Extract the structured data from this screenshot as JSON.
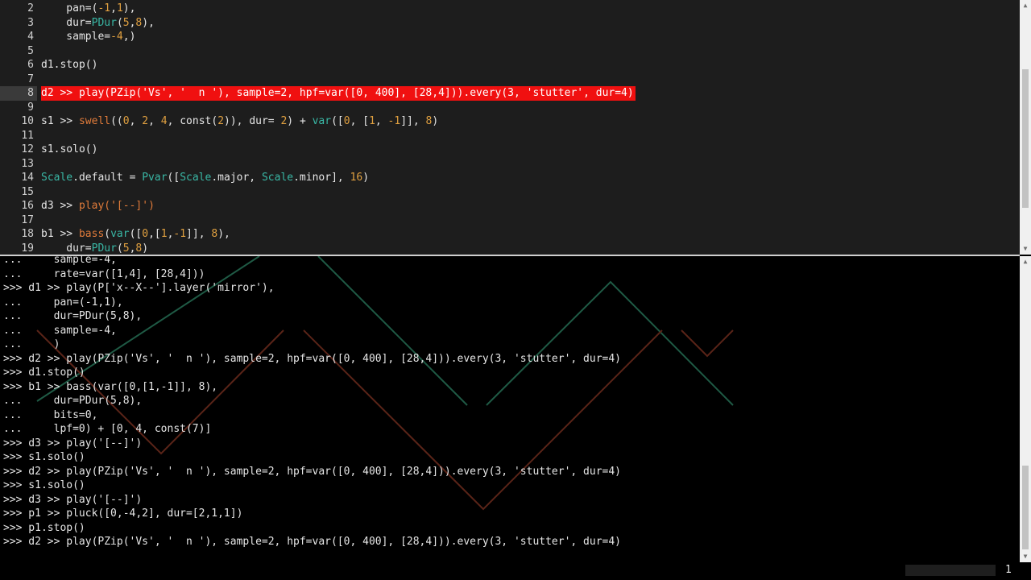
{
  "editor": {
    "line_numbers": [
      "2",
      "3",
      "4",
      "5",
      "6",
      "7",
      "8",
      "9",
      "10",
      "11",
      "12",
      "13",
      "14",
      "15",
      "16",
      "17",
      "18",
      "19"
    ],
    "active_line": "8",
    "lines": [
      [
        {
          "t": "    pan=(",
          "c": "st"
        },
        {
          "t": "-1",
          "c": "num"
        },
        {
          "t": ",",
          "c": "st"
        },
        {
          "t": "1",
          "c": "num"
        },
        {
          "t": "),",
          "c": "st"
        }
      ],
      [
        {
          "t": "    dur=",
          "c": "st"
        },
        {
          "t": "PDur",
          "c": "nm"
        },
        {
          "t": "(",
          "c": "st"
        },
        {
          "t": "5",
          "c": "num"
        },
        {
          "t": ",",
          "c": "st"
        },
        {
          "t": "8",
          "c": "num"
        },
        {
          "t": "),",
          "c": "st"
        }
      ],
      [
        {
          "t": "    sample=",
          "c": "st"
        },
        {
          "t": "-4",
          "c": "num"
        },
        {
          "t": ",)",
          "c": "st"
        }
      ],
      [],
      [
        {
          "t": "d1.stop()",
          "c": "st"
        }
      ],
      [],
      [
        {
          "t": "d2 >> play(PZip('Vs', '  n '), sample=2, hpf=var([0, 400], [28,4])).every(3, 'stutter', dur=4)",
          "c": "st"
        }
      ],
      [],
      [
        {
          "t": "s1 >> ",
          "c": "st"
        },
        {
          "t": "swell",
          "c": "fn"
        },
        {
          "t": "((",
          "c": "st"
        },
        {
          "t": "0",
          "c": "num"
        },
        {
          "t": ", ",
          "c": "st"
        },
        {
          "t": "2",
          "c": "num"
        },
        {
          "t": ", ",
          "c": "st"
        },
        {
          "t": "4",
          "c": "num"
        },
        {
          "t": ", const(",
          "c": "st"
        },
        {
          "t": "2",
          "c": "num"
        },
        {
          "t": ")), dur= ",
          "c": "st"
        },
        {
          "t": "2",
          "c": "num"
        },
        {
          "t": ") + ",
          "c": "st"
        },
        {
          "t": "var",
          "c": "nm"
        },
        {
          "t": "([",
          "c": "st"
        },
        {
          "t": "0",
          "c": "num"
        },
        {
          "t": ", [",
          "c": "st"
        },
        {
          "t": "1",
          "c": "num"
        },
        {
          "t": ", ",
          "c": "st"
        },
        {
          "t": "-1",
          "c": "num"
        },
        {
          "t": "]], ",
          "c": "st"
        },
        {
          "t": "8",
          "c": "num"
        },
        {
          "t": ")",
          "c": "st"
        }
      ],
      [],
      [
        {
          "t": "s1.solo()",
          "c": "st"
        }
      ],
      [],
      [
        {
          "t": "Scale",
          "c": "nm"
        },
        {
          "t": ".default = ",
          "c": "st"
        },
        {
          "t": "Pvar",
          "c": "nm"
        },
        {
          "t": "([",
          "c": "st"
        },
        {
          "t": "Scale",
          "c": "nm"
        },
        {
          "t": ".major, ",
          "c": "st"
        },
        {
          "t": "Scale",
          "c": "nm"
        },
        {
          "t": ".minor], ",
          "c": "st"
        },
        {
          "t": "16",
          "c": "num"
        },
        {
          "t": ")",
          "c": "st"
        }
      ],
      [],
      [
        {
          "t": "d3 >> ",
          "c": "st"
        },
        {
          "t": "play",
          "c": "fn"
        },
        {
          "t": "('[--]')",
          "c": "fn"
        }
      ],
      [],
      [
        {
          "t": "b1 >> ",
          "c": "st"
        },
        {
          "t": "bass",
          "c": "fn"
        },
        {
          "t": "(",
          "c": "st"
        },
        {
          "t": "var",
          "c": "nm"
        },
        {
          "t": "([",
          "c": "st"
        },
        {
          "t": "0",
          "c": "num"
        },
        {
          "t": ",[",
          "c": "st"
        },
        {
          "t": "1",
          "c": "num"
        },
        {
          "t": ",",
          "c": "st"
        },
        {
          "t": "-1",
          "c": "num"
        },
        {
          "t": "]], ",
          "c": "st"
        },
        {
          "t": "8",
          "c": "num"
        },
        {
          "t": "),",
          "c": "st"
        }
      ],
      [
        {
          "t": "    dur=",
          "c": "st"
        },
        {
          "t": "PDur",
          "c": "nm"
        },
        {
          "t": "(",
          "c": "st"
        },
        {
          "t": "5",
          "c": "num"
        },
        {
          "t": ",",
          "c": "st"
        },
        {
          "t": "8",
          "c": "num"
        },
        {
          "t": ")",
          "c": "st"
        }
      ]
    ]
  },
  "console": {
    "lines": [
      "...     sample=-4,",
      "...     rate=var([1,4], [28,4]))",
      ">>> d1 >> play(P['x--X--'].layer('mirror'),",
      "...     pan=(-1,1),",
      "...     dur=PDur(5,8),",
      "...     sample=-4,",
      "...     )",
      ">>> d2 >> play(PZip('Vs', '  n '), sample=2, hpf=var([0, 400], [28,4])).every(3, 'stutter', dur=4)",
      ">>> d1.stop()",
      ">>> b1 >> bass(var([0,[1,-1]], 8),",
      "...     dur=PDur(5,8),",
      "...     bits=0,",
      "...     lpf=0) + [0, 4, const(7)]",
      ">>> d3 >> play('[--]')",
      ">>> s1.solo()",
      ">>> d2 >> play(PZip('Vs', '  n '), sample=2, hpf=var([0, 400], [28,4])).every(3, 'stutter', dur=4)",
      ">>> s1.solo()",
      ">>> d3 >> play('[--]')",
      ">>> p1 >> pluck([0,-4,2], dur=[2,1,1])",
      ">>> p1.stop()",
      ">>> d2 >> play(PZip('Vs', '  n '), sample=2, hpf=var([0, 400], [28,4])).every(3, 'stutter', dur=4)"
    ]
  },
  "status": {
    "number": "1"
  },
  "colors": {
    "highlight": "#f01010",
    "number": "#e0a040",
    "function": "#e07b3a",
    "name": "#39b7a5",
    "viz_green": "#1f5a45",
    "viz_red": "#5a2418"
  }
}
